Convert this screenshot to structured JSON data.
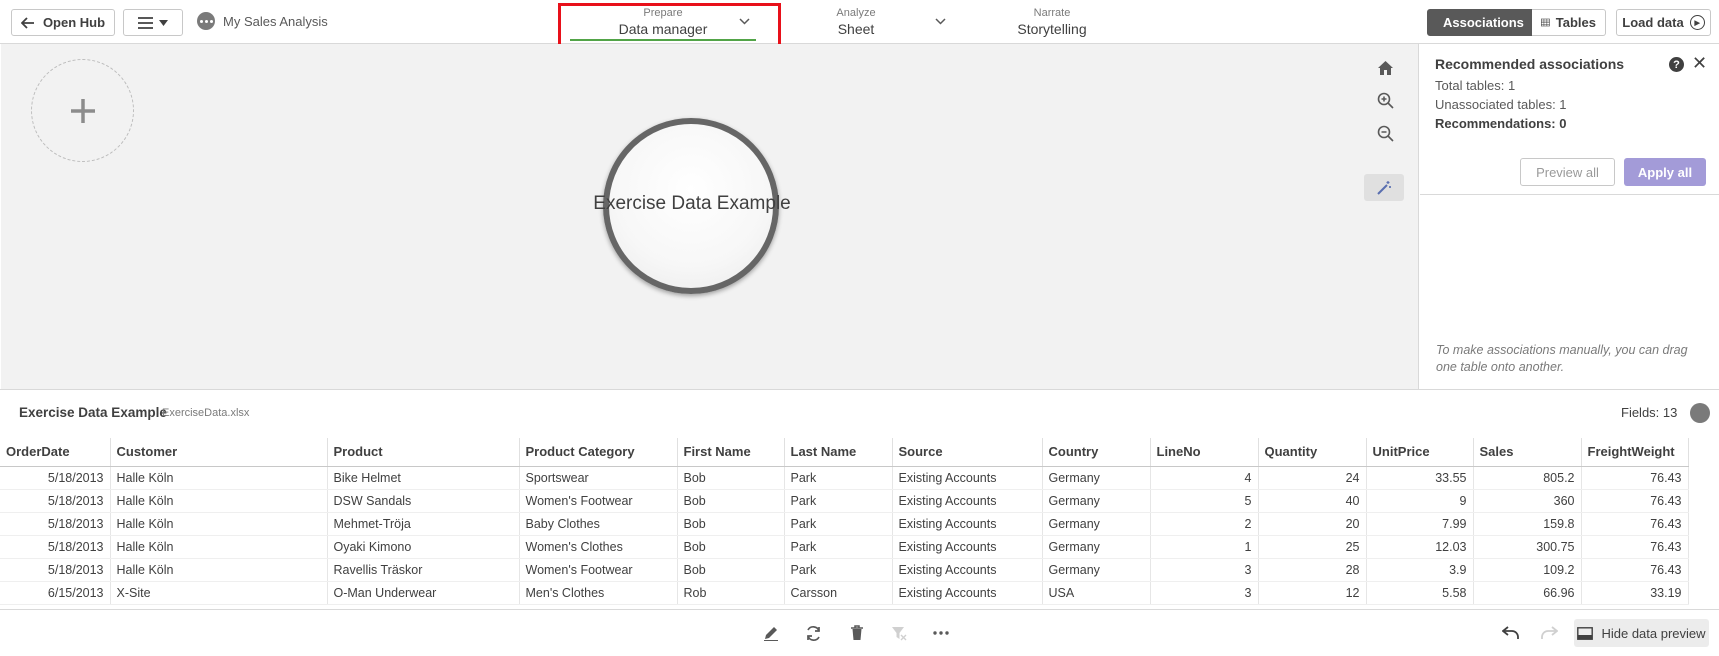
{
  "topbar": {
    "open_hub_label": "Open Hub",
    "app_name": "My Sales Analysis",
    "tabs": [
      {
        "small": "Prepare",
        "label": "Data manager"
      },
      {
        "small": "Analyze",
        "label": "Sheet"
      },
      {
        "small": "Narrate",
        "label": "Storytelling"
      }
    ],
    "associations_label": "Associations",
    "tables_label": "Tables",
    "load_data_label": "Load data",
    "accent_color": "#52a448",
    "highlight_color": "#e8101a"
  },
  "canvas": {
    "table_bubble_label": "Exercise Data Example"
  },
  "recommended": {
    "title": "Recommended associations",
    "total_tables": "Total tables: 1",
    "unassociated_tables": "Unassociated tables: 1",
    "recommendations": "Recommendations: 0",
    "preview_all_label": "Preview all",
    "apply_all_label": "Apply all",
    "hint": "To make associations manually, you can drag one table onto another."
  },
  "preview": {
    "table_name": "Exercise Data Example",
    "file_name": "ExerciseData.xlsx",
    "fields_label": "Fields: 13",
    "columns": [
      "OrderDate",
      "Customer",
      "Product",
      "Product Category",
      "First Name",
      "Last Name",
      "Source",
      "Country",
      "LineNo",
      "Quantity",
      "UnitPrice",
      "Sales",
      "FreightWeight"
    ],
    "rows": [
      [
        "5/18/2013",
        "Halle Köln",
        "Bike Helmet",
        "Sportswear",
        "Bob",
        "Park",
        "Existing Accounts",
        "Germany",
        "4",
        "24",
        "33.55",
        "805.2",
        "76.43"
      ],
      [
        "5/18/2013",
        "Halle Köln",
        "DSW Sandals",
        "Women's Footwear",
        "Bob",
        "Park",
        "Existing Accounts",
        "Germany",
        "5",
        "40",
        "9",
        "360",
        "76.43"
      ],
      [
        "5/18/2013",
        "Halle Köln",
        "Mehmet-Tröja",
        "Baby Clothes",
        "Bob",
        "Park",
        "Existing Accounts",
        "Germany",
        "2",
        "20",
        "7.99",
        "159.8",
        "76.43"
      ],
      [
        "5/18/2013",
        "Halle Köln",
        "Oyaki Kimono",
        "Women's Clothes",
        "Bob",
        "Park",
        "Existing Accounts",
        "Germany",
        "1",
        "25",
        "12.03",
        "300.75",
        "76.43"
      ],
      [
        "5/18/2013",
        "Halle Köln",
        "Ravellis Träskor",
        "Women's Footwear",
        "Bob",
        "Park",
        "Existing Accounts",
        "Germany",
        "3",
        "28",
        "3.9",
        "109.2",
        "76.43"
      ],
      [
        "6/15/2013",
        "X-Site",
        "O-Man Underwear",
        "Men's Clothes",
        "Rob",
        "Carsson",
        "Existing Accounts",
        "USA",
        "3",
        "12",
        "5.58",
        "66.96",
        "33.19"
      ]
    ]
  },
  "bottombar": {
    "hide_preview_label": "Hide data preview"
  }
}
